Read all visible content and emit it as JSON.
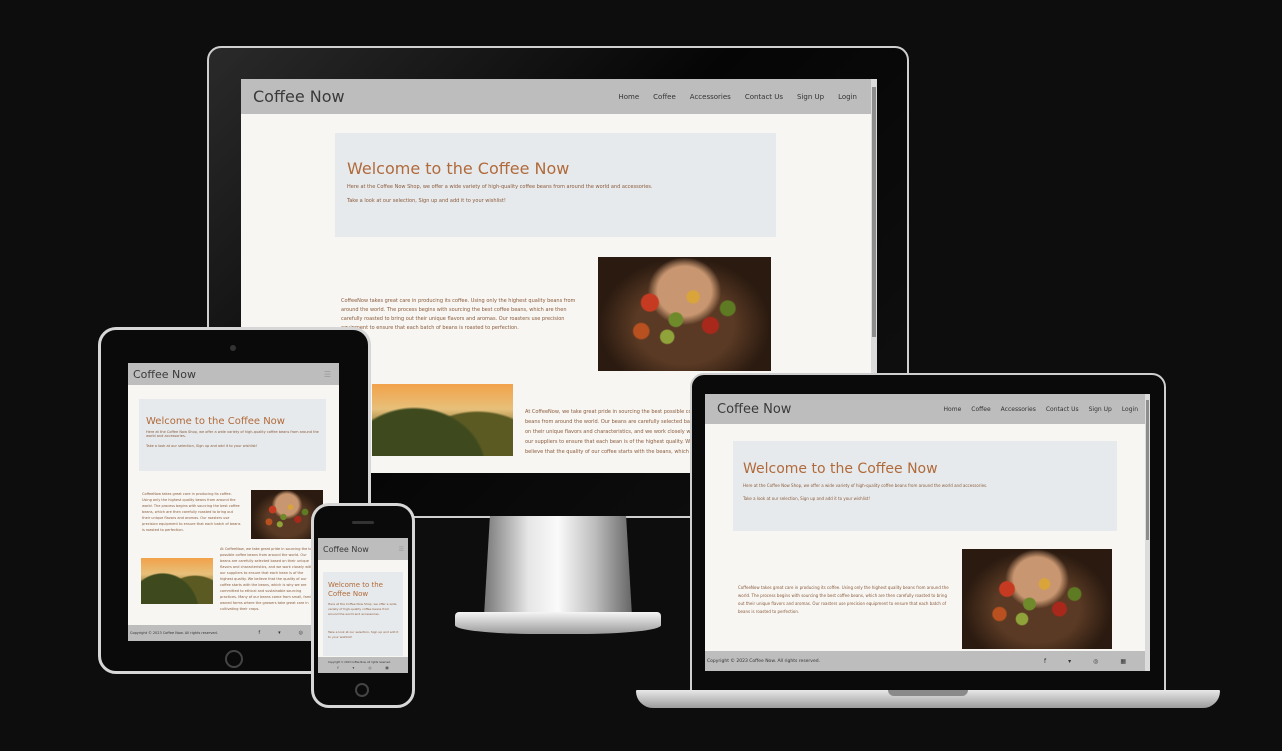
{
  "site": {
    "brand": "Coffee Now",
    "nav": [
      "Home",
      "Coffee",
      "Accessories",
      "Contact Us",
      "Sign Up",
      "Login"
    ],
    "hero_title": "Welcome to the Coffee Now",
    "hero_title_split": [
      "Welcome to the",
      "Coffee Now"
    ],
    "hero_line1": "Here at the Coffee Now Shop, we offer a wide variety of high-quality coffee beans from around the world and accessories.",
    "hero_line2": "Take a look at our selection, Sign up and add it to your wishlist!",
    "para1": "CoffeeNow takes great care in producing its coffee. Using only the highest quality beans from around the world. The process begins with sourcing the best coffee beans, which are then carefully roasted to bring out their unique flavors and aromas. Our roasters use precision equipment to ensure that each batch of beans is roasted to perfection.",
    "para2": "At CoffeeNow, we take great pride in sourcing the best possible coffee beans from around the world. Our beans are carefully selected based on their unique flavors and characteristics, and we work closely with our suppliers to ensure that each bean is of the highest quality. We believe that the quality of our coffee starts with the beans, which is why we are committed to ethical and sustainable sourcing practices. Many of our beans come from small, family-owned farms where the growers take great care in cultivating their crops.",
    "footer_copy": "Copyright © 2023 Coffee Now. All rights reserved.",
    "social_icons": [
      "facebook-icon",
      "twitter-icon",
      "github-icon",
      "linkedin-icon"
    ],
    "social_glyphs": [
      "f",
      "▾",
      "◎",
      "▦"
    ],
    "menu_glyph": "☰"
  },
  "colors": {
    "nav_bg": "#bdbdbd",
    "hero_bg": "#e7eaec",
    "accent": "#b06a3b",
    "page_bg": "#f7f6f3"
  }
}
